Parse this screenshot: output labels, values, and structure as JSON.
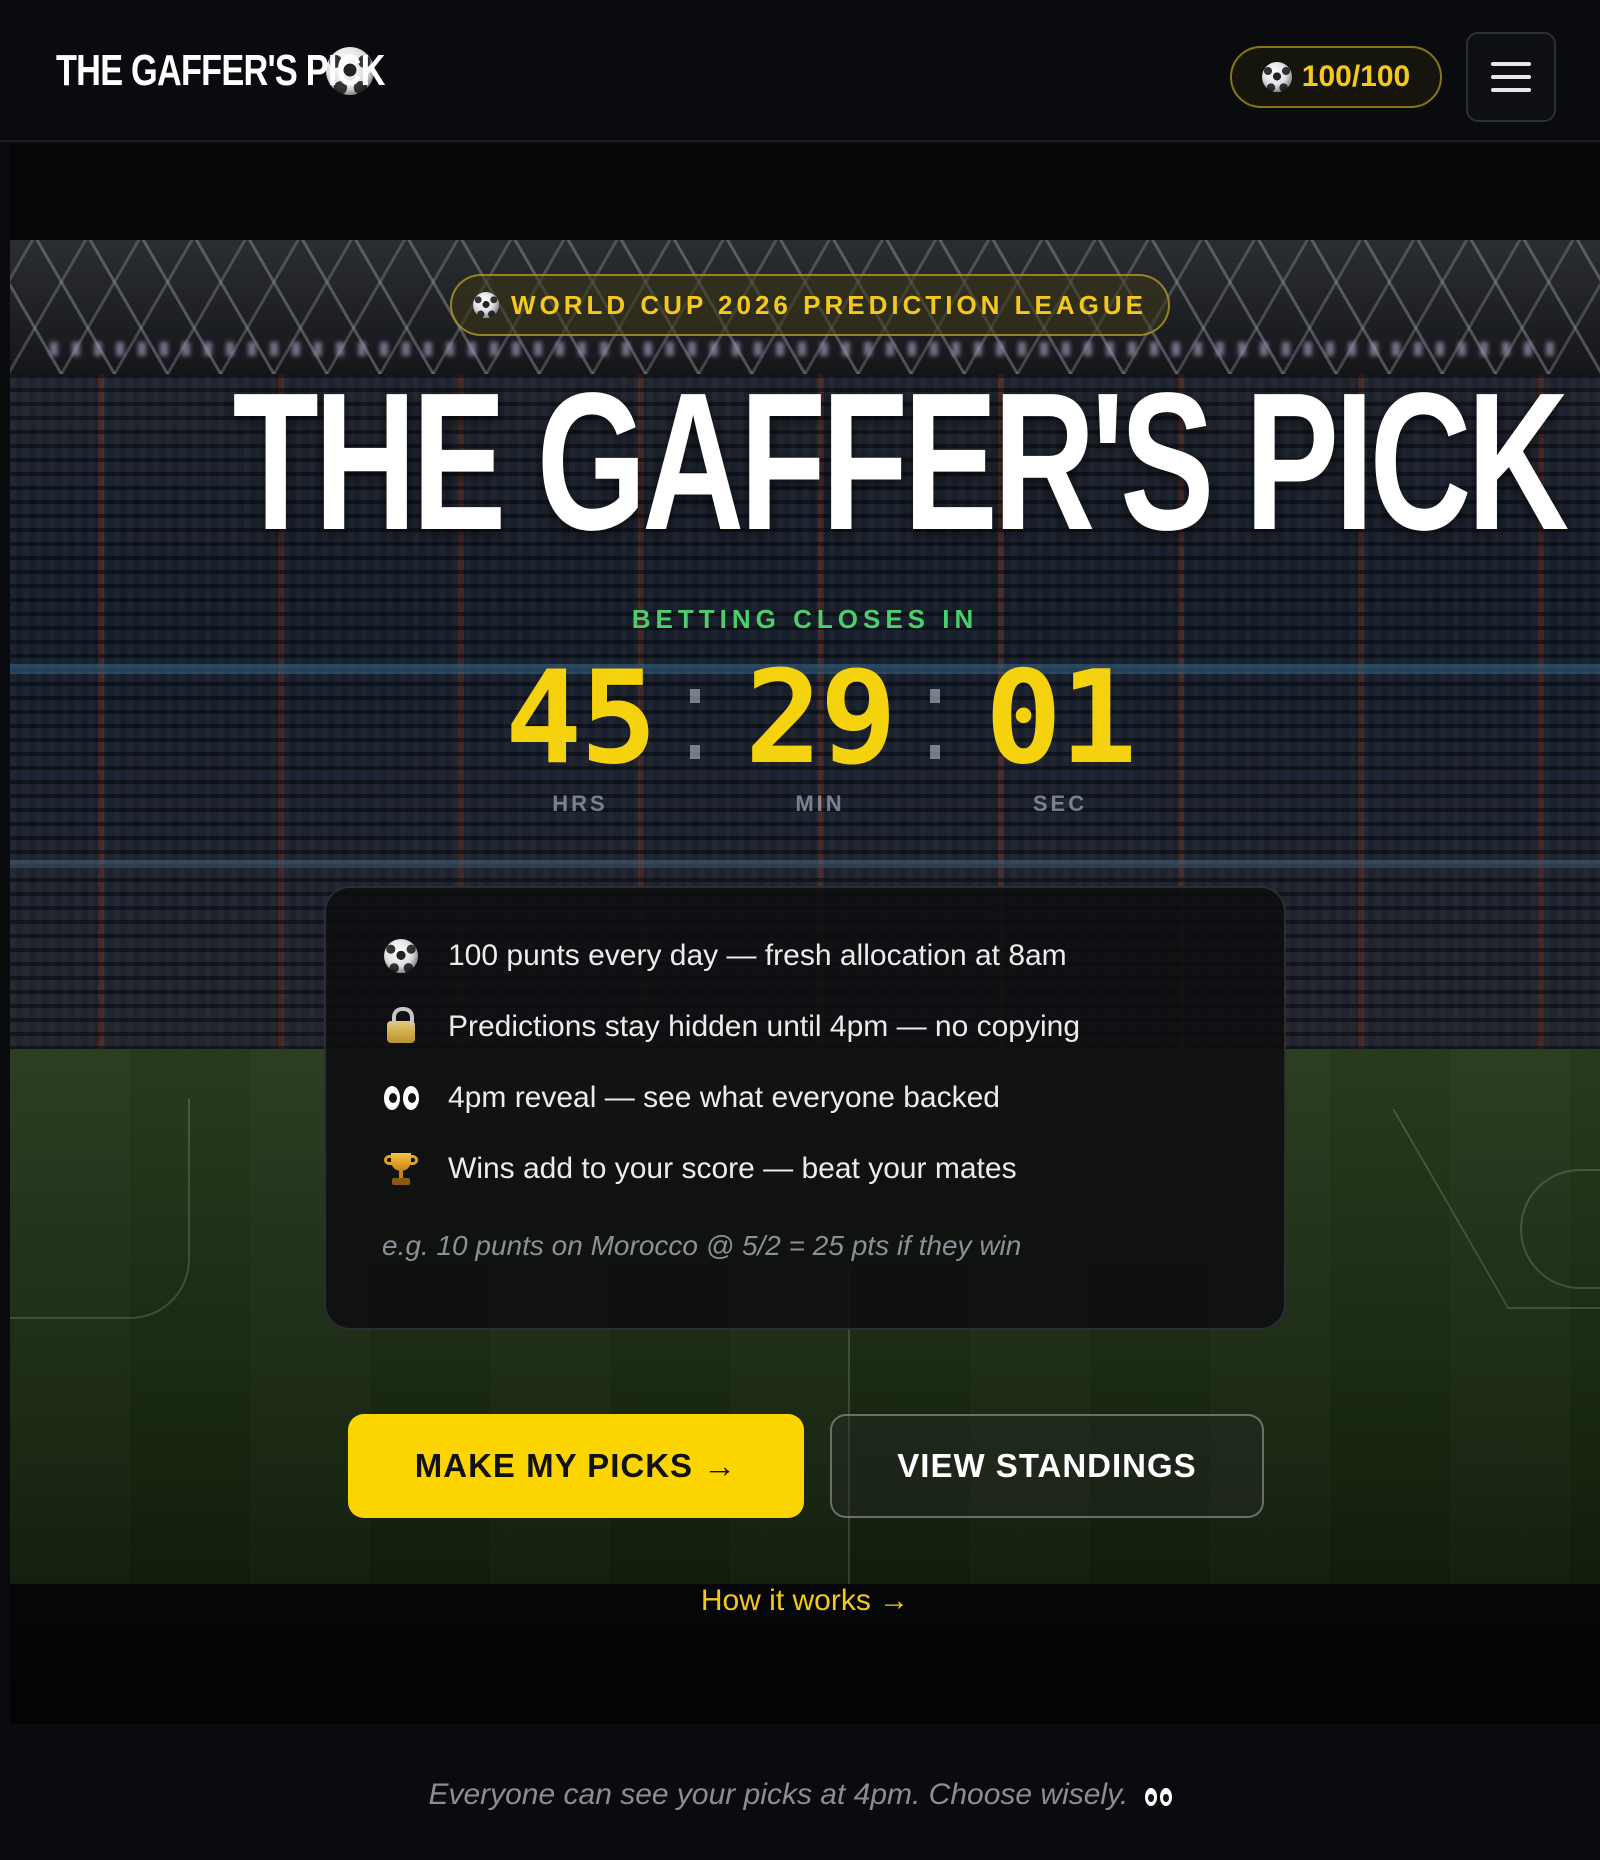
{
  "nav": {
    "brand": "THE GAFFER'S PICK",
    "brand_icon": "soccer-ball-icon",
    "balance": "100/100",
    "menu_icon": "hamburger-menu-icon"
  },
  "hero": {
    "league_label": "WORLD CUP 2026 PREDICTION LEAGUE",
    "title": "THE GAFFER'S PICK",
    "closes_label": "BETTING CLOSES IN",
    "countdown": [
      {
        "value": "45",
        "label": "HRS"
      },
      {
        "value": "29",
        "label": "MIN"
      },
      {
        "value": "01",
        "label": "SEC"
      }
    ]
  },
  "info": {
    "rows": [
      {
        "icon": "soccer-ball-icon",
        "text": "100 punts every day — fresh allocation at 8am"
      },
      {
        "icon": "lock-icon",
        "text": "Predictions stay hidden until 4pm — no copying"
      },
      {
        "icon": "eyes-icon",
        "text": "4pm reveal — see what everyone backed"
      },
      {
        "icon": "trophy-icon",
        "text": "Wins add to your score — beat your mates"
      }
    ],
    "example": "e.g. 10 punts on Morocco @ 5/2 = 25 pts if they win"
  },
  "actions": {
    "primary": "MAKE MY PICKS →",
    "secondary": "VIEW STANDINGS",
    "how_link": "How it works →"
  },
  "footer": {
    "note": "Everyone can see your picks at 4pm. Choose wisely."
  },
  "colors": {
    "accent": "#fcd500",
    "countdown": "#f5d20e",
    "closes": "#4ccf6b",
    "background": "#0a0b0e"
  }
}
